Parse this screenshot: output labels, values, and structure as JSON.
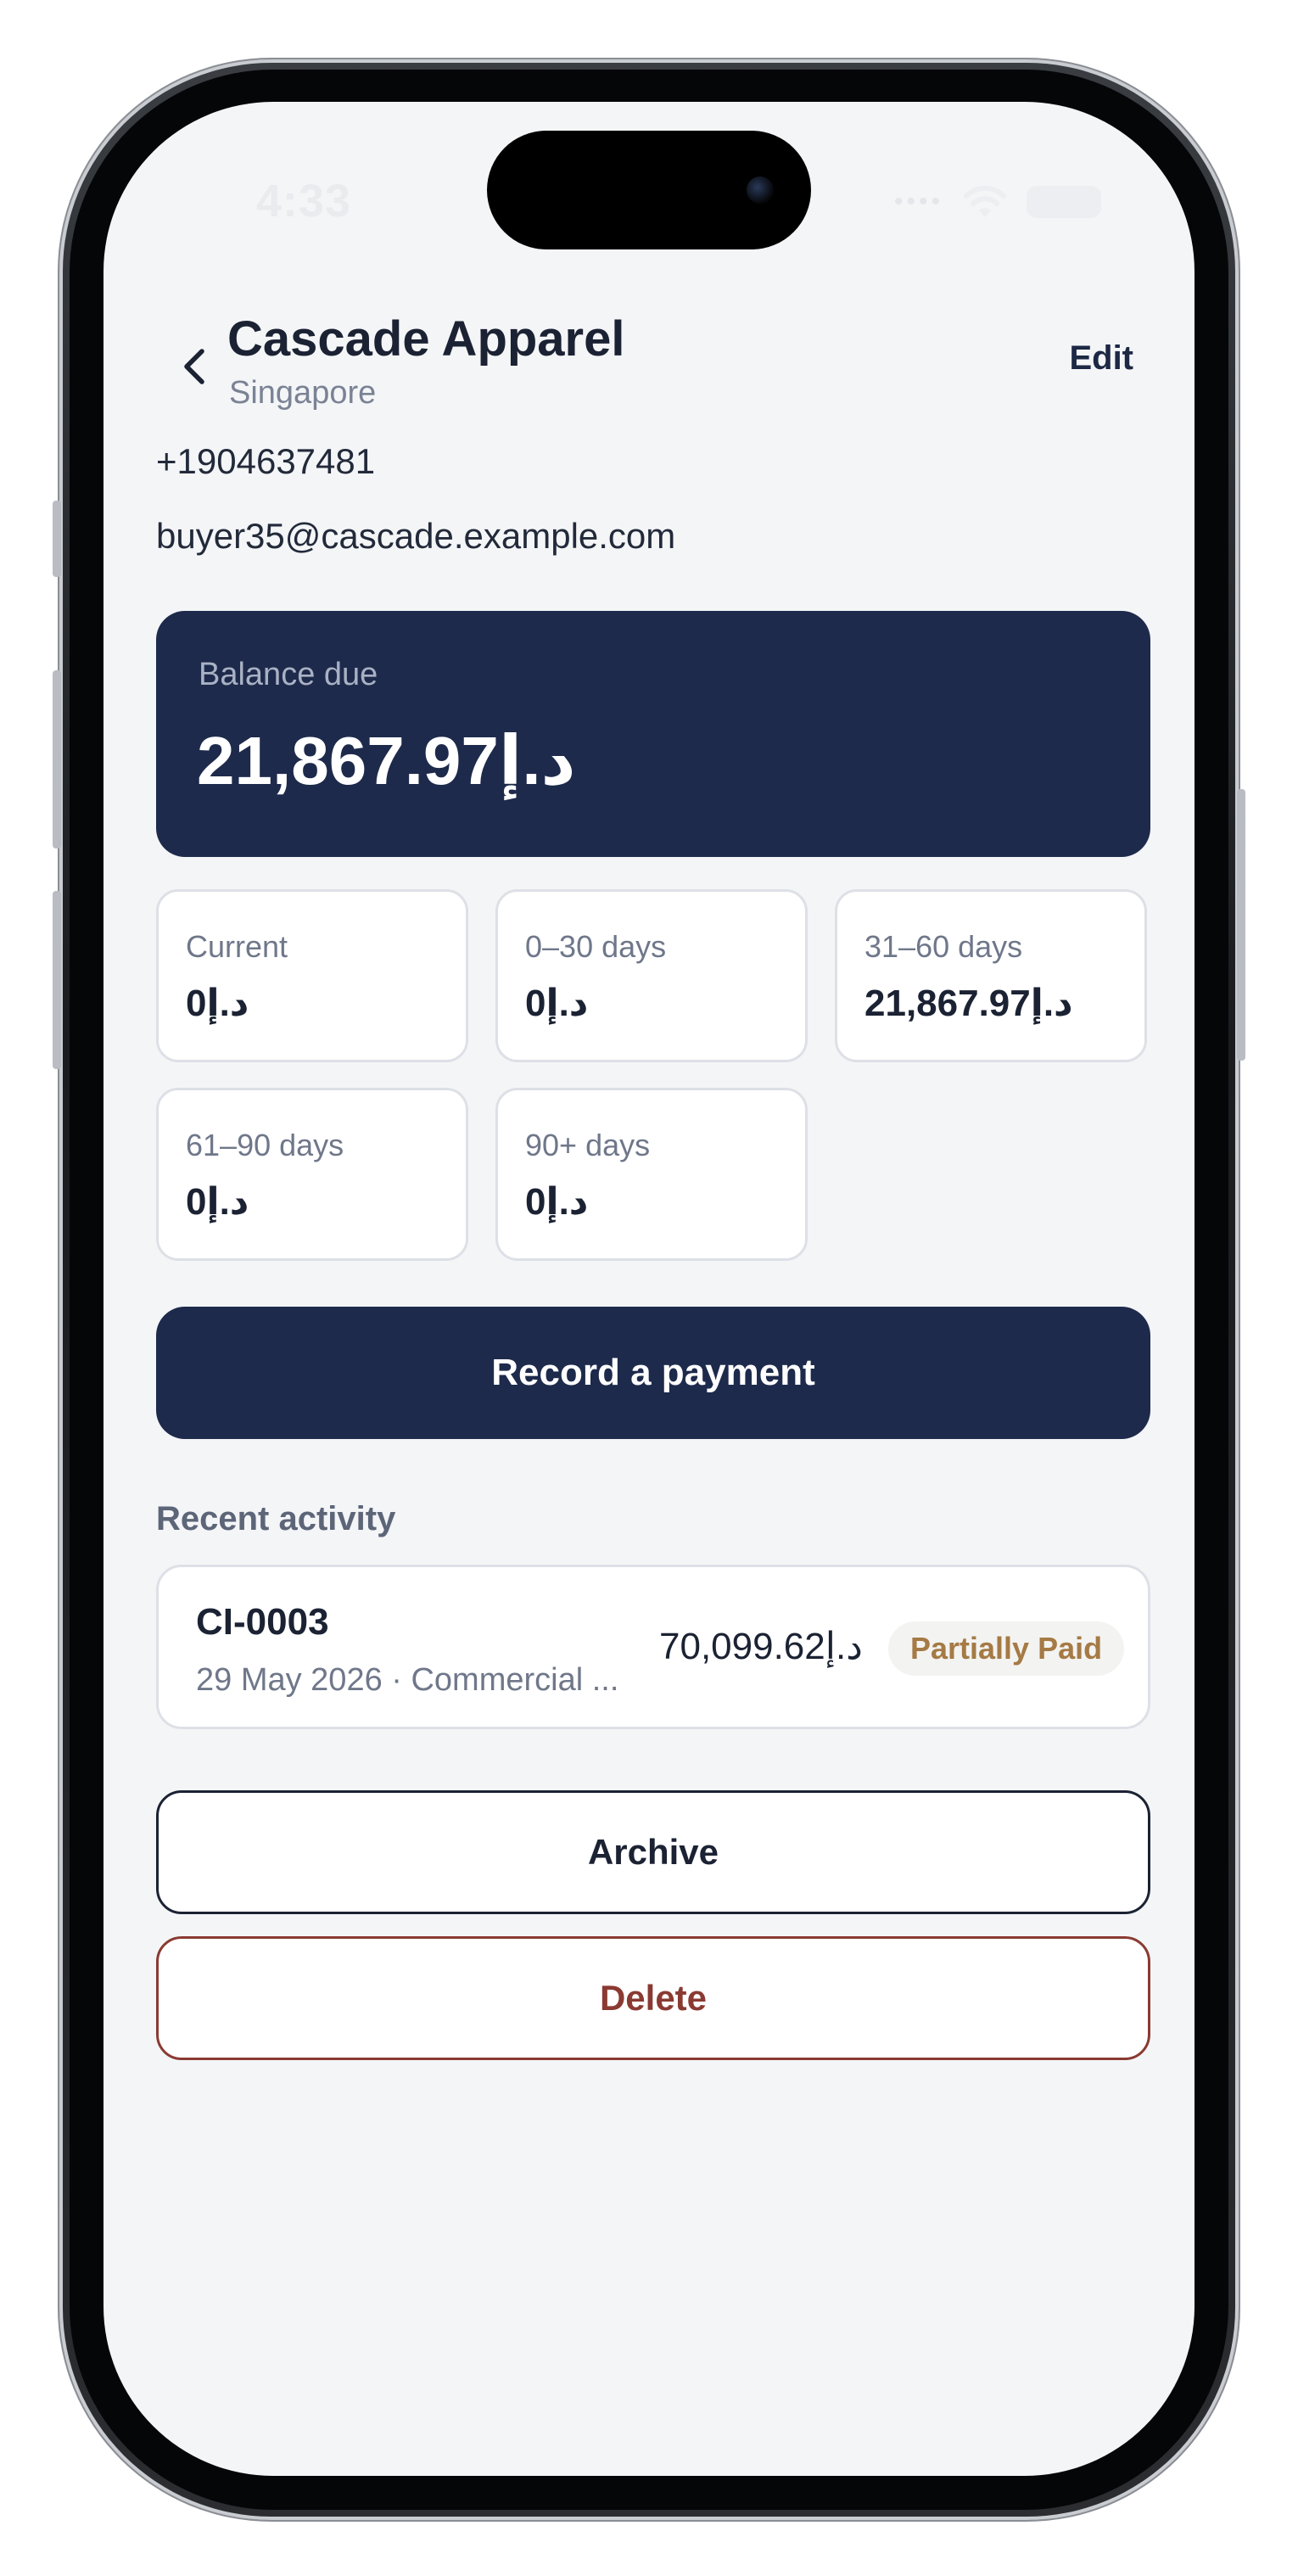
{
  "status_bar": {
    "time": "4:33",
    "signal_icon": "signal-dots-icon",
    "wifi_icon": "wifi-icon",
    "battery_icon": "battery-icon"
  },
  "header": {
    "back_icon": "chevron-left-icon",
    "title": "Cascade Apparel",
    "subtitle": "Singapore",
    "edit_label": "Edit"
  },
  "contact": {
    "phone": "+1904637481",
    "email": "buyer35@cascade.example.com"
  },
  "balance": {
    "label": "Balance due",
    "amount": "21,867.97د.إ"
  },
  "aging": [
    {
      "label": "Current",
      "value": "0د.إ"
    },
    {
      "label": "0–30 days",
      "value": "0د.إ"
    },
    {
      "label": "31–60 days",
      "value": "21,867.97د.إ"
    },
    {
      "label": "61–90 days",
      "value": "0د.إ"
    },
    {
      "label": "90+ days",
      "value": "0د.إ"
    }
  ],
  "actions": {
    "record_payment": "Record a payment",
    "archive": "Archive",
    "delete": "Delete"
  },
  "recent_activity": {
    "title": "Recent activity",
    "items": [
      {
        "id": "CI-0003",
        "meta": "29 May 2026 · Commercial ...",
        "amount": "70,099.62د.إ",
        "status": "Partially Paid"
      }
    ]
  },
  "colors": {
    "primary": "#1d2a4b",
    "danger": "#8a3a32",
    "badge_text": "#a57a45",
    "background": "#f4f5f7"
  }
}
